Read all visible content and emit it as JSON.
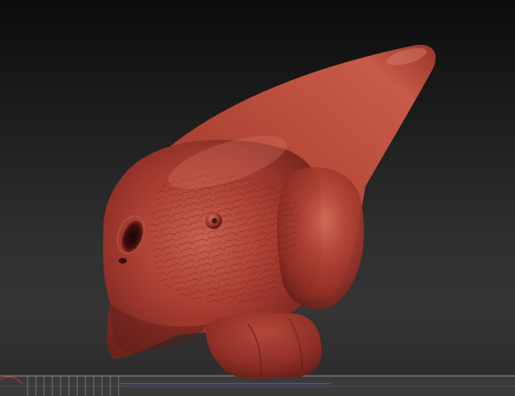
{
  "canvas": {
    "background_top": "#0c0c0c",
    "background_bottom": "#343434",
    "model_color": "#a83a30",
    "model_highlight": "#d06a58",
    "model_shadow": "#4a1512",
    "grid_color": "#8a8a8a",
    "axis_red": "#c0392b",
    "axis_blue": "#3a5fc0"
  },
  "model": {
    "type": "3d-sculpt",
    "material": "red clay",
    "features": [
      "eye-socket",
      "nostril",
      "skin-texture",
      "jaw",
      "horn-snout"
    ]
  }
}
